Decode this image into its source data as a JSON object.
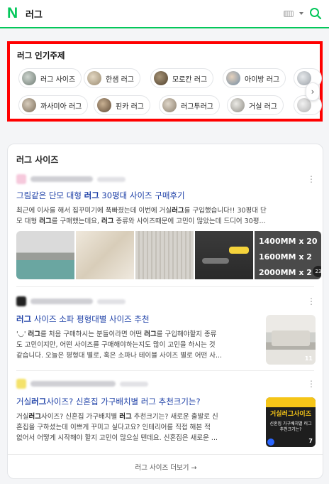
{
  "header": {
    "logo": "N",
    "query": "러그"
  },
  "topics": {
    "title": "러그 인기주제",
    "chips": [
      {
        "label": "러그 사이즈",
        "thumb_color": "#8d8f8a"
      },
      {
        "label": "한샘 러그",
        "thumb_color": "#b9a98e"
      },
      {
        "label": "모로칸 러그",
        "thumb_color": "#6b5b45"
      },
      {
        "label": "아이방 러그",
        "thumb_color": "#a3b5c6"
      },
      {
        "label": "",
        "thumb_color": "#c9cdd2"
      },
      {
        "label": "까사미아 러그",
        "thumb_color": "#9c8e7d"
      },
      {
        "label": "핀카 러그",
        "thumb_color": "#7e6a56"
      },
      {
        "label": "러그투러그",
        "thumb_color": "#a89d8e"
      },
      {
        "label": "거실 러그",
        "thumb_color": "#b8b5ae"
      },
      {
        "label": "",
        "thumb_color": "#d6d6d6"
      }
    ],
    "next_icon": "chevron-right-icon"
  },
  "section": {
    "title": "러그 사이즈",
    "more_link": "러그 사이즈 더보기 →"
  },
  "results": [
    {
      "title_pre": "그림같은 단모 대형 ",
      "title_bold": "러그",
      "title_post": " 30평대 사이즈 구매후기",
      "desc": [
        [
          "최근에 이사를 해서 집꾸미기에 푹빠졌는데 이번에 거실",
          "러그",
          "를 구입했습니다!! 30평대 단"
        ],
        [
          "모 대형 ",
          "러그",
          "를 구매했는데요, ",
          "러그",
          " 종류와 사이즈때문에 고민이 많았는데 드디어 30평..."
        ]
      ],
      "strip_sizes": [
        "1400MM x 20",
        "1600MM x 2",
        "2000MM x 2"
      ],
      "strip_count": "23"
    },
    {
      "title_pre": "",
      "title_bold": "러그",
      "title_post": " 사이즈 소파 평형대별 사이즈 추천",
      "desc": [
        [
          "'◡' ",
          "러그",
          "를 처음 구매하시는 분들이라면 어떤 ",
          "러그",
          "를 구입해야할지 종류"
        ],
        [
          "도 고민이지만, 어떤 사이즈를 구매해야하는지도 많이 고민을 하시는 것"
        ],
        [
          "같습니다. 오늘은 평형대 별로, 혹은 소파나 테이블 사이즈 별로 어떤 사..."
        ]
      ],
      "thumb_count": "11"
    },
    {
      "title_pre": "거실",
      "title_bold": "러그",
      "title_post": "사이즈? 신혼집 가구배치별 러그 추천크기는?",
      "desc": [
        [
          "거실",
          "러그",
          "사이즈? 신혼집 가구배치별 ",
          "러그",
          " 추천크기는? 새로운 출발로 신"
        ],
        [
          "혼집을 구하셨는데 이쁘게 꾸미고 싶다고요? 인테리어를 직접 해본 적"
        ],
        [
          "없어서 어떻게 시작해야 할지 고민이 많으실 텐데요. 신혼집은 새로운 ..."
        ]
      ],
      "thumb_title": "거실러그사이즈",
      "thumb_sub": "신혼집 가구배치별 러그 추천크기는?",
      "thumb_count": "7"
    }
  ],
  "colors": {
    "brand": "#03c75a",
    "highlight_border": "#ff0000",
    "link": "#1b3ea6"
  }
}
